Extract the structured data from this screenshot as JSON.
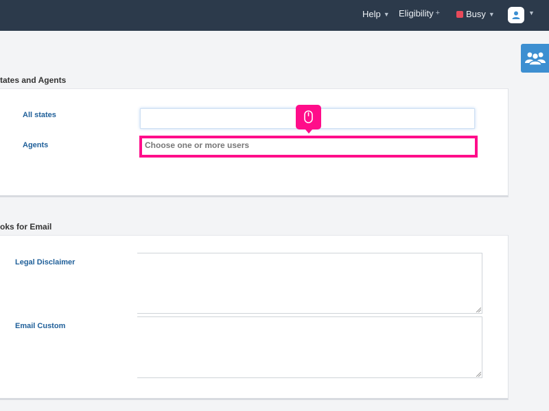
{
  "topbar": {
    "help_label": "Help",
    "eligibility_label": "Eligibility",
    "status_label": "Busy",
    "status_color": "#e84a5a",
    "background": "#2c3a4b"
  },
  "side_tab": {
    "icon": "users-icon",
    "color": "#3d8fd1"
  },
  "section1": {
    "title": "tates and Agents",
    "all_states_label": "All states",
    "all_states_value": "",
    "agents_label": "Agents",
    "agents_placeholder": "Choose one or more users"
  },
  "section2": {
    "title": "oks for Email",
    "legal_disclaimer_label": "Legal Disclaimer",
    "legal_disclaimer_value": "",
    "email_custom_label": "Email Custom",
    "email_custom_value": ""
  },
  "highlight": {
    "color": "#ff0d8a",
    "icon": "mouse-icon"
  }
}
